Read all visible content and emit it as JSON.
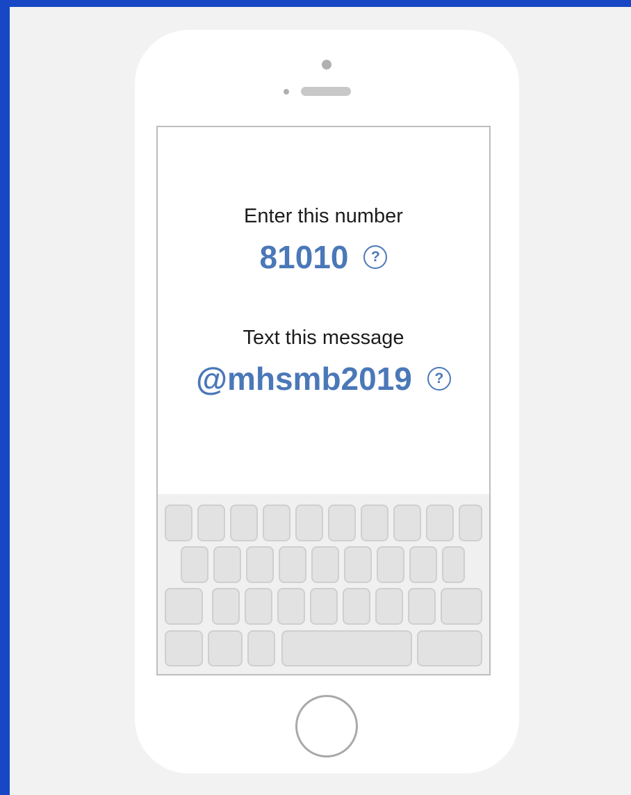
{
  "instructions": {
    "number_label": "Enter this number",
    "number_value": "81010",
    "message_label": "Text this message",
    "message_value": "@mhsmb2019",
    "help_glyph": "?"
  },
  "icons": {
    "help": "question-circle-icon"
  },
  "colors": {
    "outer_background": "#1747c4",
    "page_background": "#f2f2f2",
    "accent": "#4a78b8"
  }
}
